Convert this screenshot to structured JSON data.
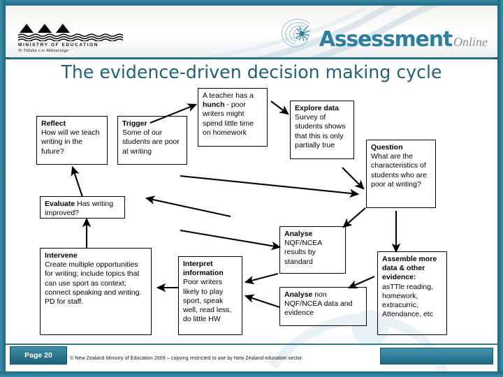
{
  "header": {
    "ministry_name": "MINISTRY OF EDUCATION",
    "ministry_maori": "Te Tāhuhu o te Mātauranga",
    "brand_word": "Assessment",
    "brand_sub": "Online",
    "accent_color": "#2d7fa0",
    "frame_color": "#1d6b82"
  },
  "slide": {
    "title": "The evidence-driven decision making cycle"
  },
  "diagram": {
    "boxes": [
      {
        "id": "reflect",
        "heading": "Reflect",
        "body": "How will we teach writing in the future?"
      },
      {
        "id": "trigger",
        "heading": "Trigger",
        "body": "Some of our students are poor at writing"
      },
      {
        "id": "hunch",
        "lead": "A teacher has a ",
        "heading": "hunch",
        "body": " - poor writers might spend little time on homework"
      },
      {
        "id": "explore-data",
        "heading": "Explore data",
        "body": "Survey of students shows that this is only partially true"
      },
      {
        "id": "question",
        "heading": "Question",
        "body": "What are the characteristics of students who are poor at writing?"
      },
      {
        "id": "evaluate",
        "heading": "Evaluate",
        "body": " Has writing improved?"
      },
      {
        "id": "intervene",
        "heading": "Intervene",
        "body": "Create multiple opportunities for writing; include topics that can use sport as context; connect speaking and writing. PD for staff."
      },
      {
        "id": "interpret",
        "heading": "Interpret information",
        "body": "Poor writers likely to play sport, speak well, read less, do little HW"
      },
      {
        "id": "analyse-nqf",
        "heading": "Analyse",
        "body": "NQF/NCEA results by standard"
      },
      {
        "id": "analyse-non-nqf",
        "heading": "Analyse",
        "body": " non NQF/NCEA data and evidence"
      },
      {
        "id": "assemble",
        "heading": "Assemble more data  & other evidence:",
        "body": "asTTle reading, homework, extracurric, Attendance, etc"
      }
    ]
  },
  "footer": {
    "page_label": "Page 20",
    "copyright": "© New Zealand Ministry of Education 2009 – copying restricted to use by New Zealand education sector."
  }
}
